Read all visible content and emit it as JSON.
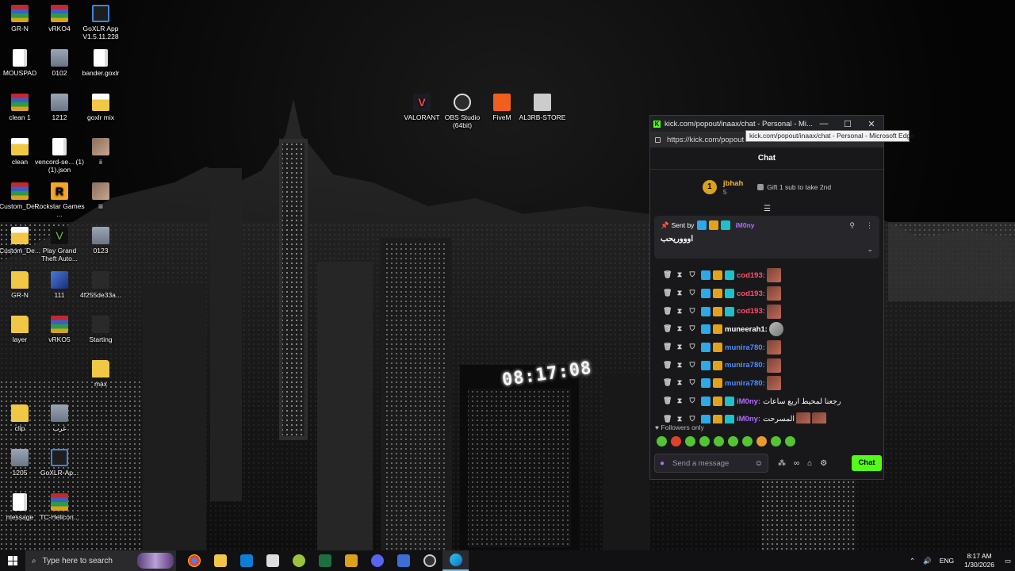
{
  "desktop": {
    "icons": [
      {
        "label": "GR-N",
        "icon": "winrar-icon"
      },
      {
        "label": "vRKO4",
        "icon": "winrar-icon"
      },
      {
        "label": "GoXLR App V1.5.11.228",
        "icon": "goxlr-icon"
      },
      {
        "label": "MOUSPAD",
        "icon": "file-icon"
      },
      {
        "label": "0102",
        "icon": "image-icon"
      },
      {
        "label": "bander.goxlr",
        "icon": "file-icon"
      },
      {
        "label": "clean 1",
        "icon": "winrar-icon"
      },
      {
        "label": "1212",
        "icon": "image-icon"
      },
      {
        "label": "goxlr mix",
        "icon": "folder-icon"
      },
      {
        "label": "clean",
        "icon": "folder-icon"
      },
      {
        "label": "vencord-se... (1) (1).json",
        "icon": "file-icon"
      },
      {
        "label": "ii",
        "icon": "photo-icon"
      },
      {
        "label": "Custom_De...",
        "icon": "winrar-icon"
      },
      {
        "label": "Rockstar Games ...",
        "icon": "rockstar-icon"
      },
      {
        "label": "iii",
        "icon": "photo-icon"
      },
      {
        "label": "Custom_De...",
        "icon": "folder-icon"
      },
      {
        "label": "Play Grand Theft Auto...",
        "icon": "gta-icon"
      },
      {
        "label": "0123",
        "icon": "image-icon"
      },
      {
        "label": "GR-N",
        "icon": "folder-icon"
      },
      {
        "label": "111",
        "icon": "lightning-icon"
      },
      {
        "label": "4f255de33a...",
        "icon": "dark-file-icon"
      },
      {
        "label": "layer",
        "icon": "folder-icon"
      },
      {
        "label": "vRKO5",
        "icon": "winrar-icon"
      },
      {
        "label": "Starting",
        "icon": "dark-file-icon"
      },
      {
        "label": "max",
        "icon": "folder-icon"
      },
      {
        "label": "clip",
        "icon": "folder-icon"
      },
      {
        "label": "غرب",
        "icon": "image-icon"
      },
      {
        "label": "1205",
        "icon": "image-icon"
      },
      {
        "label": "GoXLR-Ap...",
        "icon": "goxlr-icon"
      },
      {
        "label": "message",
        "icon": "file-icon"
      },
      {
        "label": "TC-Helicon...",
        "icon": "winrar-icon"
      },
      {
        "label": "VALORANT",
        "icon": "valorant-icon"
      },
      {
        "label": "OBS Studio (64bit)",
        "icon": "obs-icon"
      },
      {
        "label": "FiveM",
        "icon": "fivem-icon"
      },
      {
        "label": "AL3RB-STORE",
        "icon": "store-icon"
      }
    ],
    "wallpaper_sign": "08:17:08"
  },
  "browser": {
    "title": "kick.com/popout/inaax/chat - Personal - Mi...",
    "address": "https://kick.com/popout",
    "tooltip": "kick.com/popout/inaax/chat - Personal - Microsoft Edge",
    "controls": {
      "minimize": "—",
      "maximize": "☐",
      "close": "✕"
    }
  },
  "chat": {
    "header": "Chat",
    "leaderboard": {
      "rank": "1",
      "name": "jbhah",
      "count": "5",
      "cta": "Gift 1 sub to take 2nd"
    },
    "pinned": {
      "sent_by": "Sent by",
      "user": "iM0ny",
      "message": "اوووريحب"
    },
    "messages": [
      {
        "user": "cod193:",
        "color": "#ff4f6d",
        "text": "",
        "badges": [
          "vip",
          "crown",
          "og"
        ],
        "avatars": 1
      },
      {
        "user": "cod193:",
        "color": "#ff4f6d",
        "text": "",
        "badges": [
          "vip",
          "crown",
          "og"
        ],
        "avatars": 1
      },
      {
        "user": "cod193:",
        "color": "#ff4f6d",
        "text": "",
        "badges": [
          "vip",
          "crown",
          "og"
        ],
        "avatars": 1
      },
      {
        "user": "muneerah1:",
        "color": "#ffffff",
        "text": "",
        "badges": [
          "vip",
          "crown"
        ],
        "avatars": 1
      },
      {
        "user": "munira780:",
        "color": "#4f8dff",
        "text": "",
        "badges": [
          "vip",
          "crown"
        ],
        "avatars": 1
      },
      {
        "user": "munira780:",
        "color": "#4f8dff",
        "text": "",
        "badges": [
          "vip",
          "crown"
        ],
        "avatars": 1
      },
      {
        "user": "munira780:",
        "color": "#4f8dff",
        "text": "",
        "badges": [
          "vip",
          "crown"
        ],
        "avatars": 1
      },
      {
        "user": "iM0ny:",
        "color": "#b36bff",
        "text": "رجعنا لمحيط اربع ساعات",
        "badges": [
          "vip",
          "crown",
          "og"
        ],
        "avatars": 0
      },
      {
        "user": "iM0ny:",
        "color": "#b36bff",
        "text": "المسرحت",
        "badges": [
          "vip",
          "crown",
          "og"
        ],
        "avatars": 2
      }
    ],
    "followers_only": "Followers only",
    "input_placeholder": "Send a message",
    "send_label": "Chat"
  },
  "taskbar": {
    "search_placeholder": "Type here to search",
    "language": "ENG",
    "time": "8:17 AM",
    "date": "1/30/2026"
  }
}
